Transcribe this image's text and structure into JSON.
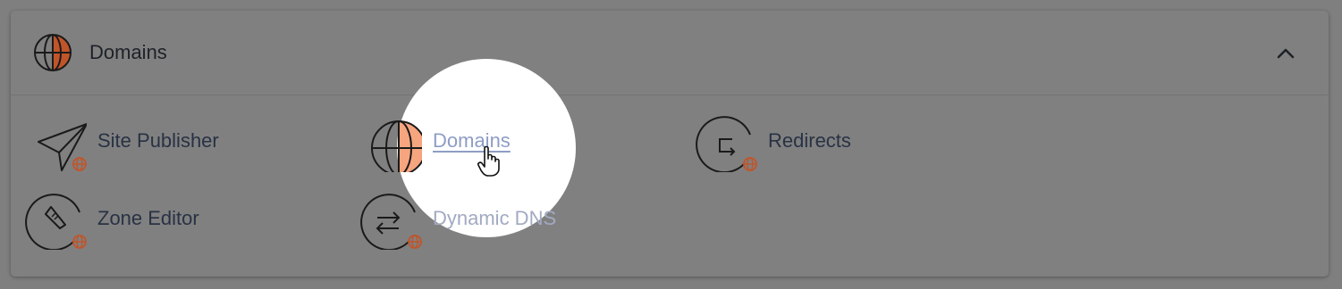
{
  "panel": {
    "title": "Domains",
    "header_icon": "globe-icon",
    "collapse_icon": "chevron-up-icon"
  },
  "tools": {
    "site_publisher": {
      "label": "Site Publisher",
      "icon": "paper-plane-globe-icon"
    },
    "domains": {
      "label": "Domains",
      "icon": "globe-icon"
    },
    "redirects": {
      "label": "Redirects",
      "icon": "redirect-arrow-globe-icon"
    },
    "zone_editor": {
      "label": "Zone Editor",
      "icon": "rocket-globe-icon"
    },
    "dynamic_dns": {
      "label": "Dynamic DNS",
      "icon": "swap-arrows-globe-icon"
    }
  },
  "colors": {
    "accent_orange": "#c0552a",
    "accent_peach": "#f7a57f",
    "label_text": "#283244",
    "highlight_link": "#8e9dc6"
  },
  "cursor": "hand-pointer-icon"
}
